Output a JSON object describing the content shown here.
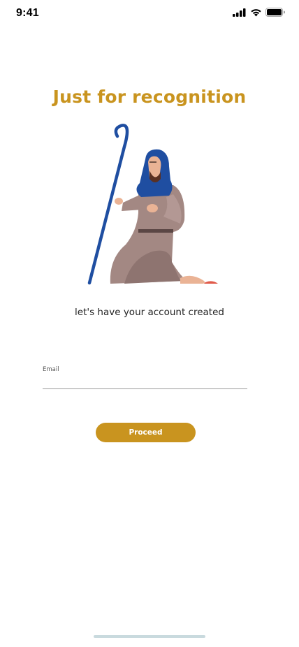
{
  "status_bar": {
    "time": "9:41",
    "icons": [
      "signal-icon",
      "wifi-icon",
      "battery-icon"
    ]
  },
  "screen": {
    "title": "Just for recognition",
    "subtitle": "let's have your account created"
  },
  "form": {
    "email_label": "Email",
    "email_value": "",
    "proceed_label": "Proceed"
  },
  "colors": {
    "accent": "#c9941f",
    "hood": "#1f4ea1",
    "robe": "#a38883",
    "skin": "#eab395"
  }
}
